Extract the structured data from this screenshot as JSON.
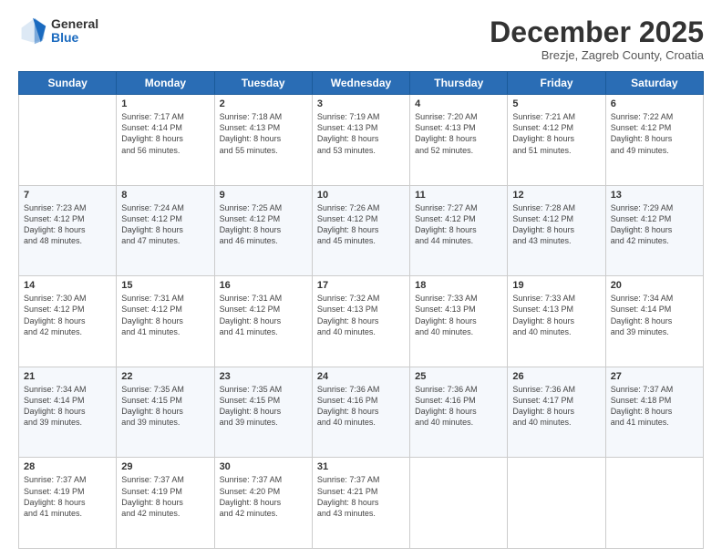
{
  "logo": {
    "general": "General",
    "blue": "Blue"
  },
  "title": "December 2025",
  "location": "Brezje, Zagreb County, Croatia",
  "days_of_week": [
    "Sunday",
    "Monday",
    "Tuesday",
    "Wednesday",
    "Thursday",
    "Friday",
    "Saturday"
  ],
  "weeks": [
    [
      {
        "day": "",
        "info": ""
      },
      {
        "day": "1",
        "info": "Sunrise: 7:17 AM\nSunset: 4:14 PM\nDaylight: 8 hours\nand 56 minutes."
      },
      {
        "day": "2",
        "info": "Sunrise: 7:18 AM\nSunset: 4:13 PM\nDaylight: 8 hours\nand 55 minutes."
      },
      {
        "day": "3",
        "info": "Sunrise: 7:19 AM\nSunset: 4:13 PM\nDaylight: 8 hours\nand 53 minutes."
      },
      {
        "day": "4",
        "info": "Sunrise: 7:20 AM\nSunset: 4:13 PM\nDaylight: 8 hours\nand 52 minutes."
      },
      {
        "day": "5",
        "info": "Sunrise: 7:21 AM\nSunset: 4:12 PM\nDaylight: 8 hours\nand 51 minutes."
      },
      {
        "day": "6",
        "info": "Sunrise: 7:22 AM\nSunset: 4:12 PM\nDaylight: 8 hours\nand 49 minutes."
      }
    ],
    [
      {
        "day": "7",
        "info": "Sunrise: 7:23 AM\nSunset: 4:12 PM\nDaylight: 8 hours\nand 48 minutes."
      },
      {
        "day": "8",
        "info": "Sunrise: 7:24 AM\nSunset: 4:12 PM\nDaylight: 8 hours\nand 47 minutes."
      },
      {
        "day": "9",
        "info": "Sunrise: 7:25 AM\nSunset: 4:12 PM\nDaylight: 8 hours\nand 46 minutes."
      },
      {
        "day": "10",
        "info": "Sunrise: 7:26 AM\nSunset: 4:12 PM\nDaylight: 8 hours\nand 45 minutes."
      },
      {
        "day": "11",
        "info": "Sunrise: 7:27 AM\nSunset: 4:12 PM\nDaylight: 8 hours\nand 44 minutes."
      },
      {
        "day": "12",
        "info": "Sunrise: 7:28 AM\nSunset: 4:12 PM\nDaylight: 8 hours\nand 43 minutes."
      },
      {
        "day": "13",
        "info": "Sunrise: 7:29 AM\nSunset: 4:12 PM\nDaylight: 8 hours\nand 42 minutes."
      }
    ],
    [
      {
        "day": "14",
        "info": "Sunrise: 7:30 AM\nSunset: 4:12 PM\nDaylight: 8 hours\nand 42 minutes."
      },
      {
        "day": "15",
        "info": "Sunrise: 7:31 AM\nSunset: 4:12 PM\nDaylight: 8 hours\nand 41 minutes."
      },
      {
        "day": "16",
        "info": "Sunrise: 7:31 AM\nSunset: 4:12 PM\nDaylight: 8 hours\nand 41 minutes."
      },
      {
        "day": "17",
        "info": "Sunrise: 7:32 AM\nSunset: 4:13 PM\nDaylight: 8 hours\nand 40 minutes."
      },
      {
        "day": "18",
        "info": "Sunrise: 7:33 AM\nSunset: 4:13 PM\nDaylight: 8 hours\nand 40 minutes."
      },
      {
        "day": "19",
        "info": "Sunrise: 7:33 AM\nSunset: 4:13 PM\nDaylight: 8 hours\nand 40 minutes."
      },
      {
        "day": "20",
        "info": "Sunrise: 7:34 AM\nSunset: 4:14 PM\nDaylight: 8 hours\nand 39 minutes."
      }
    ],
    [
      {
        "day": "21",
        "info": "Sunrise: 7:34 AM\nSunset: 4:14 PM\nDaylight: 8 hours\nand 39 minutes."
      },
      {
        "day": "22",
        "info": "Sunrise: 7:35 AM\nSunset: 4:15 PM\nDaylight: 8 hours\nand 39 minutes."
      },
      {
        "day": "23",
        "info": "Sunrise: 7:35 AM\nSunset: 4:15 PM\nDaylight: 8 hours\nand 39 minutes."
      },
      {
        "day": "24",
        "info": "Sunrise: 7:36 AM\nSunset: 4:16 PM\nDaylight: 8 hours\nand 40 minutes."
      },
      {
        "day": "25",
        "info": "Sunrise: 7:36 AM\nSunset: 4:16 PM\nDaylight: 8 hours\nand 40 minutes."
      },
      {
        "day": "26",
        "info": "Sunrise: 7:36 AM\nSunset: 4:17 PM\nDaylight: 8 hours\nand 40 minutes."
      },
      {
        "day": "27",
        "info": "Sunrise: 7:37 AM\nSunset: 4:18 PM\nDaylight: 8 hours\nand 41 minutes."
      }
    ],
    [
      {
        "day": "28",
        "info": "Sunrise: 7:37 AM\nSunset: 4:19 PM\nDaylight: 8 hours\nand 41 minutes."
      },
      {
        "day": "29",
        "info": "Sunrise: 7:37 AM\nSunset: 4:19 PM\nDaylight: 8 hours\nand 42 minutes."
      },
      {
        "day": "30",
        "info": "Sunrise: 7:37 AM\nSunset: 4:20 PM\nDaylight: 8 hours\nand 42 minutes."
      },
      {
        "day": "31",
        "info": "Sunrise: 7:37 AM\nSunset: 4:21 PM\nDaylight: 8 hours\nand 43 minutes."
      },
      {
        "day": "",
        "info": ""
      },
      {
        "day": "",
        "info": ""
      },
      {
        "day": "",
        "info": ""
      }
    ]
  ]
}
